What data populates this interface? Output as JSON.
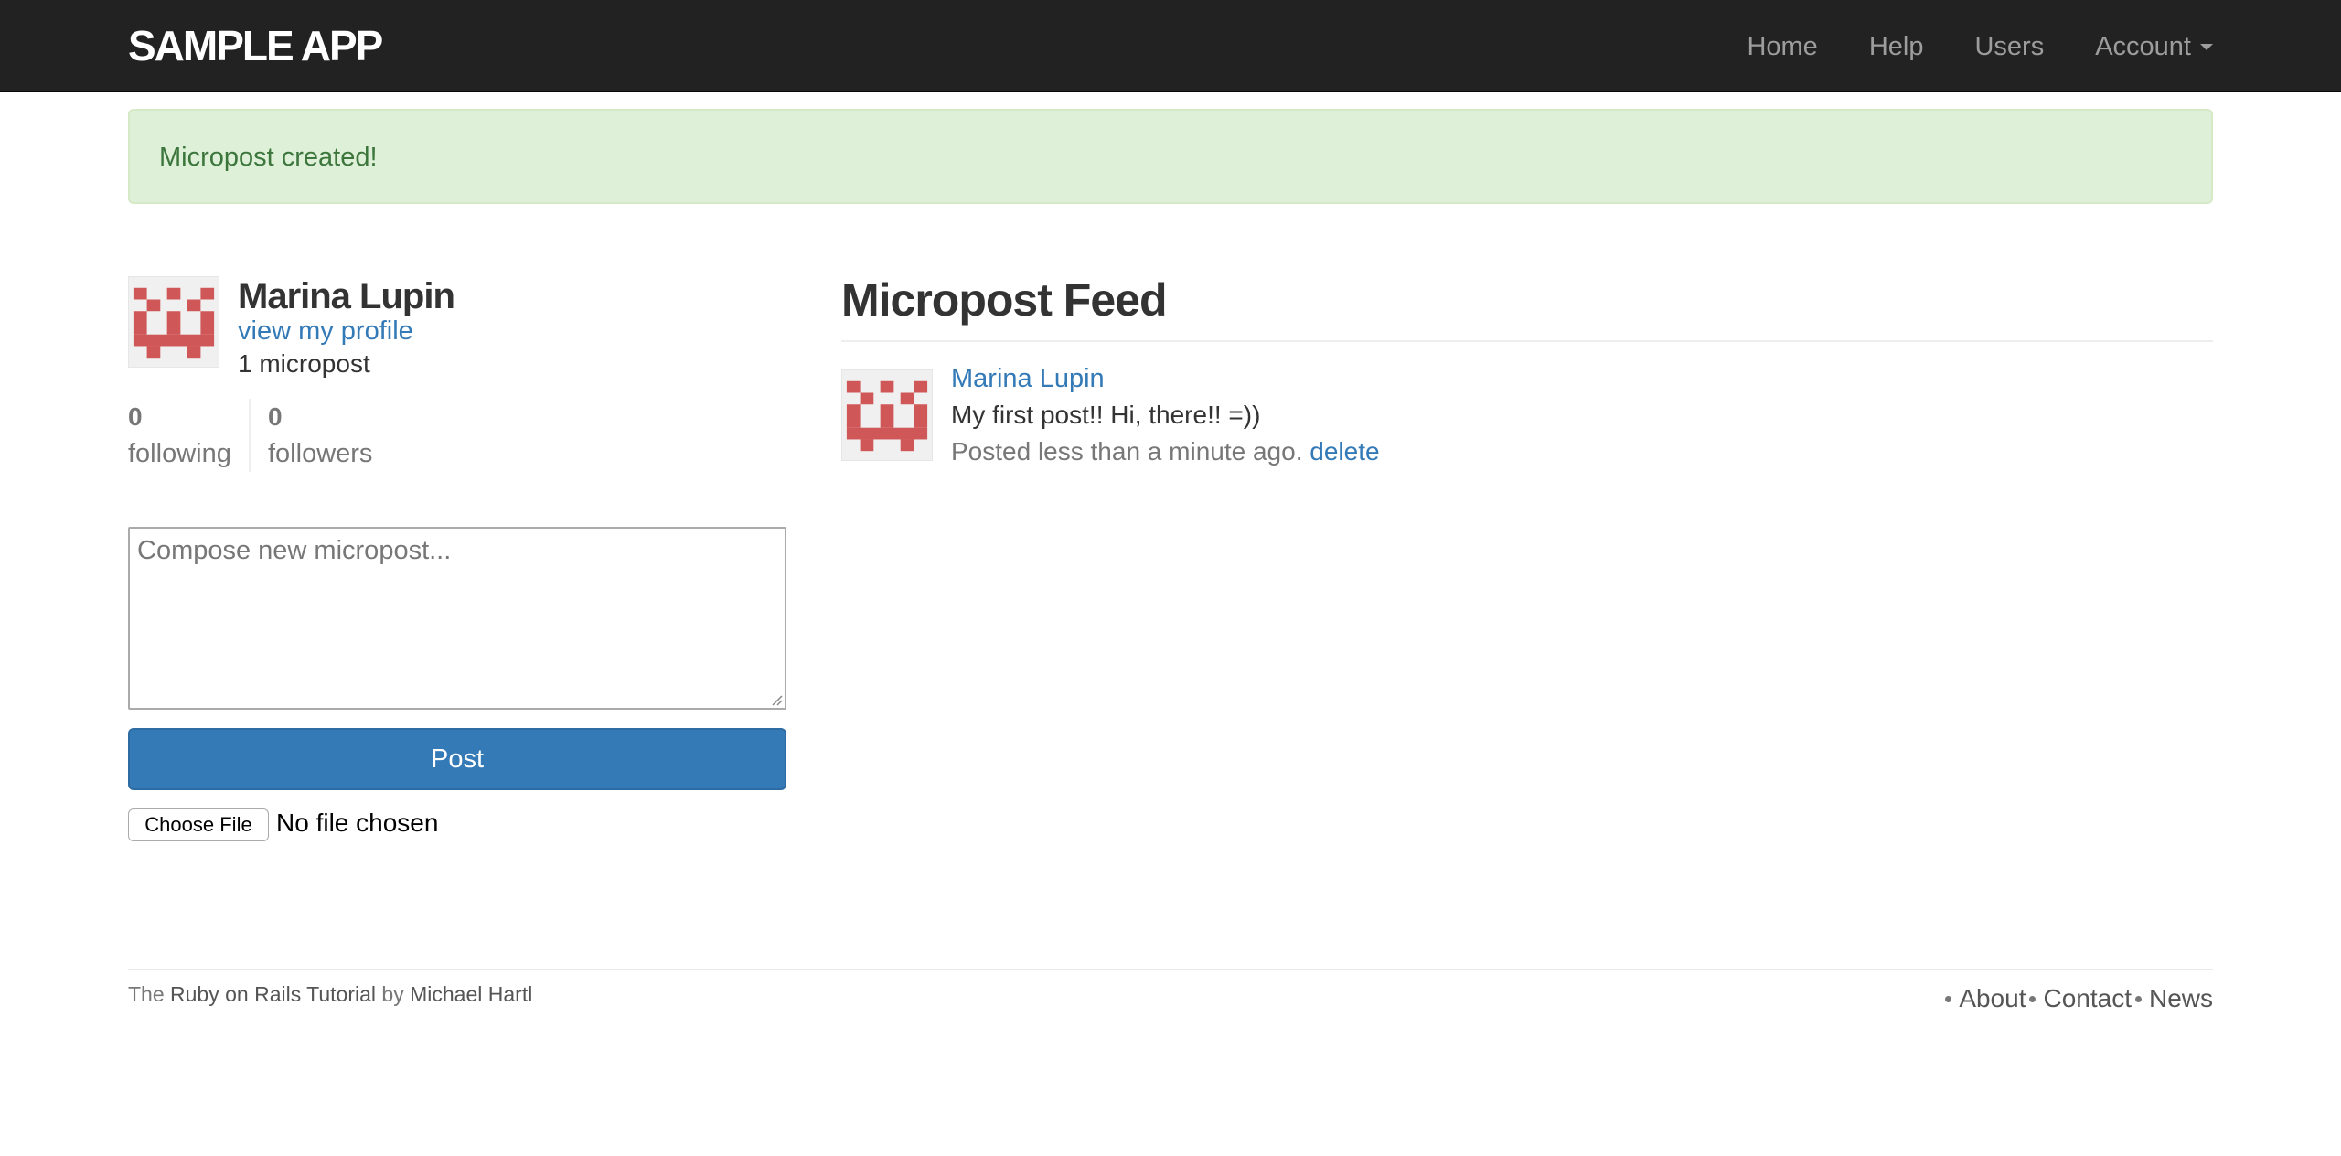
{
  "navbar": {
    "logo": "SAMPLE APP",
    "links": [
      "Home",
      "Help",
      "Users",
      "Account"
    ]
  },
  "alert": {
    "text": "Micropost created!"
  },
  "user_info": {
    "name": "Marina Lupin",
    "profile_link": "view my profile",
    "micropost_count": "1 micropost"
  },
  "stats": {
    "following_count": "0",
    "following_label": "following",
    "followers_count": "0",
    "followers_label": "followers"
  },
  "compose": {
    "placeholder": "Compose new micropost...",
    "post_button": "Post",
    "file_button": "Choose File",
    "file_status": "No file chosen"
  },
  "feed": {
    "title": "Micropost Feed",
    "items": [
      {
        "user": "Marina Lupin",
        "content": "My first post!! Hi, there!! =))",
        "meta": "Posted less than a minute ago.",
        "delete": "delete"
      }
    ]
  },
  "footer": {
    "prefix": "The",
    "tutorial_link": "Ruby on Rails Tutorial",
    "by": "by",
    "author_link": "Michael Hartl",
    "links": [
      "About",
      "Contact",
      "News"
    ]
  },
  "colors": {
    "navbar_bg": "#222222",
    "alert_bg": "#dff0d8",
    "alert_text": "#3c763d",
    "link": "#337ab7",
    "post_button": "#337ab7",
    "gravatar": "#d05757"
  },
  "icons": [
    "gravatar-icon",
    "caret-down-icon",
    "resize-grip-icon",
    "bullet-icon"
  ]
}
